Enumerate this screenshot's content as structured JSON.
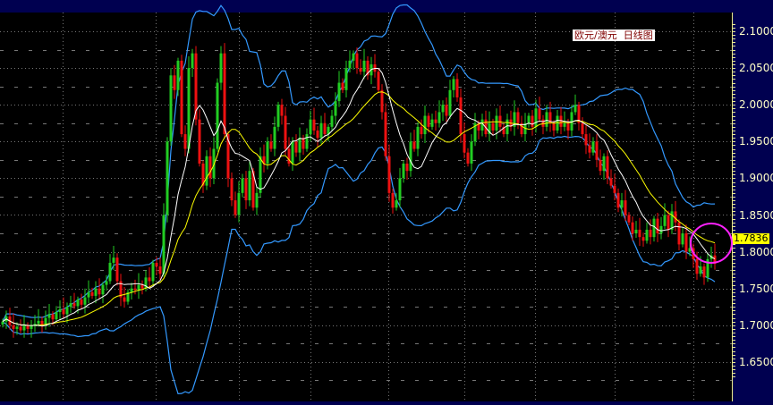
{
  "chart_data": {
    "type": "candlestick",
    "title": "欧元/澳元  日线图",
    "ylim": [
      1.625,
      2.115
    ],
    "yticks": [
      "2.1000",
      "2.0500",
      "2.0000",
      "1.9500",
      "1.9000",
      "1.8500",
      "1.8000",
      "1.7500",
      "1.7000",
      "1.6500"
    ],
    "last_price": "1.7836",
    "grid": true,
    "colors": {
      "up": "#22cc22",
      "down": "#ee1111",
      "ma_short": "#ffffff",
      "ma_long": "#ffff00",
      "bands": "#3399ff",
      "highlight": "#ff22ff",
      "axis_bg": "#000050",
      "price_tag": "#ffff00"
    },
    "indicators": {
      "ma_short_period": 10,
      "ma_long_period": 20,
      "bollinger_period": 20,
      "bollinger_k": 2
    },
    "close": [
      1.705,
      1.712,
      1.7,
      1.695,
      1.698,
      1.693,
      1.7,
      1.695,
      1.699,
      1.702,
      1.706,
      1.7,
      1.71,
      1.715,
      1.708,
      1.718,
      1.722,
      1.715,
      1.725,
      1.73,
      1.726,
      1.735,
      1.728,
      1.738,
      1.745,
      1.74,
      1.75,
      1.742,
      1.755,
      1.76,
      1.785,
      1.792,
      1.76,
      1.738,
      1.732,
      1.745,
      1.75,
      1.748,
      1.755,
      1.75,
      1.765,
      1.76,
      1.785,
      1.78,
      1.77,
      1.85,
      1.95,
      2.04,
      2.02,
      2.06,
      1.96,
      1.94,
      2.05,
      2.07,
      1.98,
      1.92,
      1.89,
      1.93,
      1.9,
      1.94,
      2.03,
      2.07,
      1.96,
      1.9,
      1.87,
      1.85,
      1.88,
      1.9,
      1.87,
      1.91,
      1.86,
      1.88,
      1.93,
      1.92,
      1.95,
      1.94,
      1.97,
      2.0,
      1.985,
      1.94,
      1.92,
      1.95,
      1.935,
      1.955,
      1.94,
      1.96,
      1.98,
      1.965,
      1.955,
      1.975,
      1.96,
      1.97,
      1.985,
      2.005,
      2.03,
      2.02,
      2.05,
      2.06,
      2.07,
      2.05,
      2.045,
      2.06,
      2.04,
      2.055,
      2.045,
      2.02,
      1.99,
      1.93,
      1.88,
      1.86,
      1.87,
      1.9,
      1.92,
      1.91,
      1.95,
      1.94,
      1.97,
      1.96,
      1.985,
      1.97,
      1.98,
      1.975,
      1.99,
      2.0,
      1.985,
      2.02,
      2.035,
      2.01,
      1.96,
      1.935,
      1.92,
      1.95,
      1.975,
      1.965,
      1.98,
      1.96,
      1.975,
      1.965,
      1.985,
      1.97,
      1.96,
      1.98,
      1.97,
      1.99,
      1.975,
      1.96,
      1.975,
      1.985,
      1.97,
      1.995,
      1.98,
      1.97,
      1.99,
      1.975,
      1.965,
      1.985,
      1.97,
      1.975,
      1.965,
      1.99,
      2.0,
      1.975,
      1.96,
      1.945,
      1.935,
      1.95,
      1.925,
      1.91,
      1.93,
      1.9,
      1.89,
      1.88,
      1.86,
      1.87,
      1.85,
      1.84,
      1.825,
      1.83,
      1.82,
      1.815,
      1.83,
      1.82,
      1.845,
      1.825,
      1.835,
      1.85,
      1.83,
      1.855,
      1.84,
      1.81,
      1.825,
      1.8,
      1.805,
      1.79,
      1.77,
      1.78,
      1.765,
      1.79,
      1.795,
      1.7836
    ]
  }
}
